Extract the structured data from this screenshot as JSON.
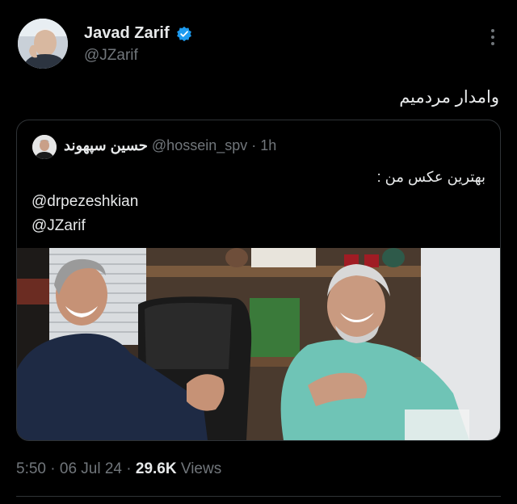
{
  "author": {
    "name": "Javad Zarif",
    "handle": "@JZarif",
    "verified": true,
    "avatar_icon": "profile-avatar"
  },
  "tweet": {
    "text": "وامدار مردمیم"
  },
  "quote": {
    "author_name": "حسین سپهوند",
    "handle": "@hossein_spv",
    "separator": "·",
    "time": "1h",
    "text": "بهترین عکس من :",
    "mentions": [
      "@drpezeshkian",
      "@JZarif"
    ],
    "photo_icon": "photo-two-men-laughing"
  },
  "meta": {
    "time": "5:50",
    "separator": "·",
    "date": "06 Jul 24",
    "views_count": "29.6K",
    "views_label": "Views"
  },
  "colors": {
    "background": "#000000",
    "text": "#e7e9ea",
    "muted": "#71767b",
    "border": "#2f3336",
    "verified": "#1d9bf0"
  }
}
